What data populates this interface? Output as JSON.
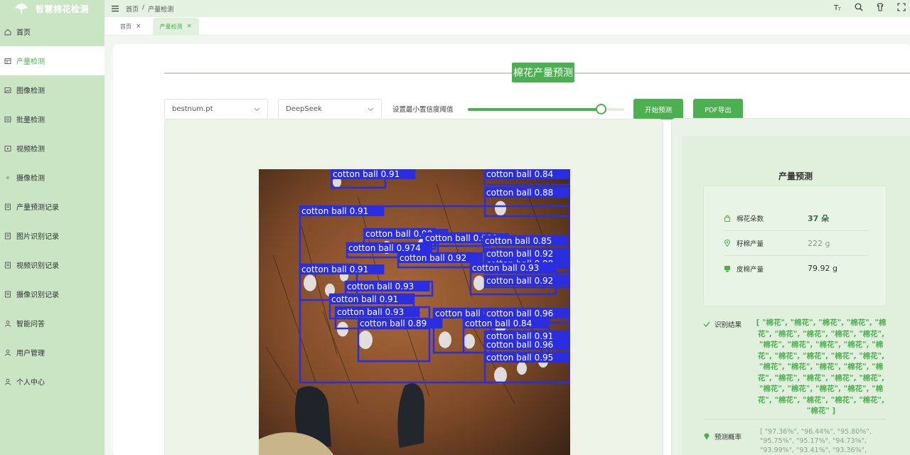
{
  "app": {
    "title": "智慧棉花检测"
  },
  "sidebar": {
    "items": [
      {
        "label": "首页",
        "icon": "home-icon"
      },
      {
        "label": "产量检测",
        "icon": "grid-icon",
        "active": true
      },
      {
        "label": "图像检测",
        "icon": "image-icon"
      },
      {
        "label": "批量检测",
        "icon": "stack-icon"
      },
      {
        "label": "视频检测",
        "icon": "video-icon"
      },
      {
        "label": "摄像检测",
        "icon": "camera-icon"
      },
      {
        "label": "产量预测记录",
        "icon": "record-icon"
      },
      {
        "label": "图片识别记录",
        "icon": "record-icon"
      },
      {
        "label": "视频识别记录",
        "icon": "record-icon"
      },
      {
        "label": "摄像识别记录",
        "icon": "record-icon"
      },
      {
        "label": "智能问答",
        "icon": "user-icon"
      },
      {
        "label": "用户管理",
        "icon": "user-icon"
      },
      {
        "label": "个人中心",
        "icon": "user-icon"
      }
    ]
  },
  "topbar": {
    "breadcrumb": [
      "首页",
      "/",
      "产量检测"
    ],
    "icons": [
      "font-size-icon",
      "search-icon",
      "theme-icon",
      "fullscreen-icon"
    ]
  },
  "tabs": [
    {
      "label": "首页",
      "close": "×"
    },
    {
      "label": "产量检测",
      "close": "×",
      "active": true
    }
  ],
  "page": {
    "title": "棉花产量预测",
    "model_select": "bestnum.pt",
    "llm_select": "DeepSeek",
    "slider_label": "设置最小置信度阈值",
    "slider_value": 0.85,
    "start_button": "开始预测",
    "pdf_button": "PDF导出"
  },
  "detections": [
    {
      "label": "cotton ball 0.91"
    },
    {
      "label": "cotton ball 0.84"
    },
    {
      "label": "cotton ball 0.88"
    },
    {
      "label": "cotton ball 0.91"
    },
    {
      "label": "cotton ball 0.90"
    },
    {
      "label": "cotton ball 0.909"
    },
    {
      "label": "cotton ball 0.85"
    },
    {
      "label": "cotton ball 0.974"
    },
    {
      "label": "cotton ball 0.92"
    },
    {
      "label": "cotton ball 0.92"
    },
    {
      "label": "cotton ball 0.88"
    },
    {
      "label": "cotton ball 0.91"
    },
    {
      "label": "cotton ball 0.93"
    },
    {
      "label": "cotton ball 0.92"
    },
    {
      "label": "cotton ball 0.93"
    },
    {
      "label": "cotton ball 0.91"
    },
    {
      "label": "cotton ball 0.93"
    },
    {
      "label": "cotton ball 0.96"
    },
    {
      "label": "cotton ball 0.96"
    },
    {
      "label": "cotton ball 0.89"
    },
    {
      "label": "cotton ball 0.84"
    },
    {
      "label": "cotton ball 0.91"
    },
    {
      "label": "cotton ball 0.96"
    },
    {
      "label": "cotton ball 0.95"
    }
  ],
  "result": {
    "title": "产量预测",
    "stats": [
      {
        "label": "棉花朵数",
        "value": "37 朵",
        "icon": "bag-icon"
      },
      {
        "label": "籽棉产量",
        "value": "222 g",
        "icon": "pin-icon"
      },
      {
        "label": "皮棉产量",
        "value": "79.92 g",
        "icon": "box-icon"
      }
    ],
    "recognition_label": "识别结果",
    "recognition_text": "[ \"棉花\", \"棉花\", \"棉花\", \"棉花\", \"棉花\", \"棉花\", \"棉花\", \"棉花\", \"棉花\", \"棉花\", \"棉花\", \"棉花\", \"棉花\", \"棉花\", \"棉花\", \"棉花\", \"棉花\", \"棉花\", \"棉花\", \"棉花\", \"棉花\", \"棉花\", \"棉花\", \"棉花\", \"棉花\", \"棉花\", \"棉花\", \"棉花\", \"棉花\", \"棉花\", \"棉花\", \"棉花\", \"棉花\", \"棉花\", \"棉花\", \"棉花\", \"棉花\" ]",
    "probability_label": "预测概率",
    "probability_text": "[ \"97.36%\", \"96.44%\", \"95.80%\", \"95.75%\", \"95.17%\", \"94.73%\", \"93.99%\", \"93.41%\", \"93.36%\","
  }
}
